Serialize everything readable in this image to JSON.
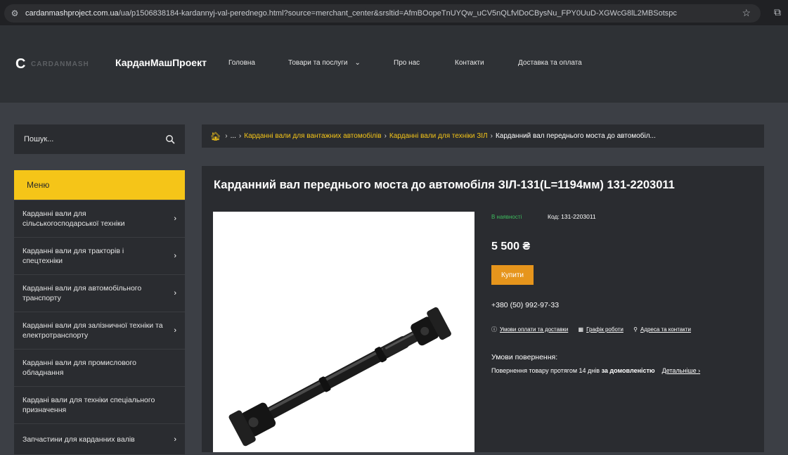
{
  "browser": {
    "url_domain": "cardanmashproject.com.ua",
    "url_rest": "/ua/p1506838184-kardannyj-val-perednego.html?source=merchant_center&srsltid=AfmBOopeTnUYQw_uCV5nQLfvlDoCBysNu_FPY0UuD-XGWcG8lL2MBSotspc",
    "star_icon": "star-icon",
    "extension_icon": "extensions-icon"
  },
  "header": {
    "logo_letter": "C",
    "logo_ghost": "CARDANMASH",
    "brand": "КарданМашПроект",
    "nav": [
      "Головна",
      "Товари та послуги",
      "Про нас",
      "Контакти",
      "Доставка та оплата"
    ]
  },
  "search": {
    "placeholder": "Пошук..."
  },
  "menu": {
    "title": "Меню",
    "items": [
      "Карданні вали для сільськогосподарської техніки",
      "Карданні вали для тракторів і спецтехніки",
      "Карданні вали для автомобільного транспорту",
      "Карданні вали для залізничної техніки та електротранспорту",
      "Карданні вали для промислового обладнання",
      "Карданi вали для техніки спеціального призначення",
      "Запчастини для карданних валів"
    ]
  },
  "breadcrumb": {
    "ellipsis": "...",
    "links": [
      "Карданні вали для вантажних автомобілів",
      "Карданні вали для техніки ЗІЛ"
    ],
    "current": "Карданний вал переднього моста до автомобіл..."
  },
  "product": {
    "title": "Карданний вал переднього моста до автомобіля ЗІЛ-131(L=1194мм) 131-2203011",
    "stock": "В наявності",
    "code": "Код: 131-2203011",
    "price": "5 500 ₴",
    "buy_label": "Купити",
    "phone": "+380 (50) 992-97-33",
    "link_payment": "Умови оплати та доставки",
    "link_schedule": "Графік роботи",
    "link_address": "Адреса та контакти",
    "return_title": "Умови повернення:",
    "return_text": "Повернення товару протягом 14 днів",
    "return_bold": "за домовленістю",
    "return_more": "Детальніше"
  },
  "colors": {
    "accent": "#f5c518",
    "buy_button": "#e6951c",
    "in_stock": "#3dbb5d",
    "panel": "#2a2c30",
    "page_bg": "#3c3f45"
  }
}
